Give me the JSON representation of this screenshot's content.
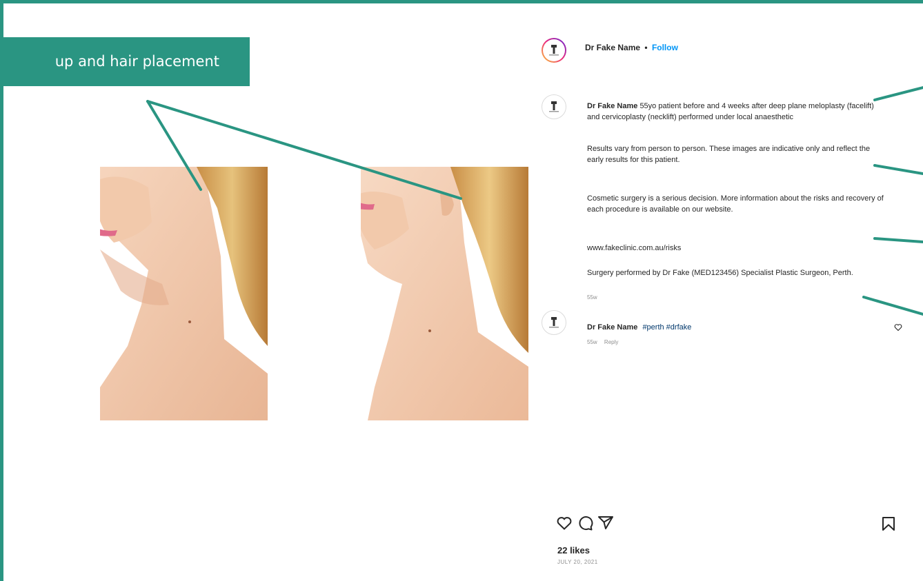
{
  "annotation": {
    "label": "up and hair placement",
    "color": "#2a9582"
  },
  "post": {
    "header_name": "Dr Fake Name",
    "header_sep": "•",
    "follow_label": "Follow",
    "caption_name": "Dr Fake Name",
    "caption_text": "55yo patient before and 4 weeks after deep plane meloplasty (facelift) and cervicoplasty (necklift) performed under local anaesthetic",
    "disclaimer_1": "Results vary from person to person. These images are indicative only and reflect the early results for this patient.",
    "disclaimer_2": "Cosmetic surgery is a serious decision. More information about the risks and recovery of each procedure is available on our website.",
    "link": "www.fakeclinic.com.au/risks",
    "surgeon": "Surgery performed by Dr Fake (MED123456) Specialist Plastic Surgeon, Perth.",
    "caption_age": "55w",
    "comment_name": "Dr Fake Name",
    "comment_text": "#perth #drfake",
    "comment_age": "55w",
    "comment_reply": "Reply",
    "likes": "22 likes",
    "date": "JULY 20, 2021"
  },
  "icons": [
    "avatar-logo-icon",
    "heart-icon",
    "comment-icon",
    "share-icon",
    "bookmark-icon",
    "small-heart-icon"
  ],
  "colors": {
    "accent": "#2a9582",
    "follow": "#0095f6",
    "muted": "#8e8e8e",
    "skin": "#f0c8a8",
    "hair": "#d9a860"
  }
}
